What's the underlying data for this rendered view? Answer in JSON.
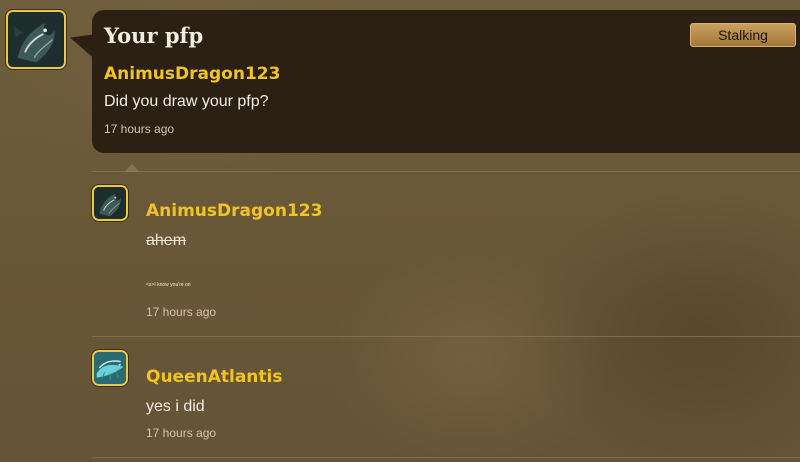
{
  "post": {
    "title": "Your pfp",
    "stalk_button": "Stalking",
    "author": "AnimusDragon123",
    "message": "Did you draw your pfp?",
    "time": "17 hours ago",
    "avatar_icon": "dragon-avatar-icon"
  },
  "comments": [
    {
      "author": "AnimusDragon123",
      "message": "ahem",
      "small_text": "<s>I know you're on",
      "time": "17 hours ago",
      "avatar_icon": "dragon-avatar-icon"
    },
    {
      "author": "QueenAtlantis",
      "message": "yes i did",
      "time": "17 hours ago",
      "avatar_icon": "teal-creature-avatar-icon"
    }
  ],
  "colors": {
    "username": "#f0c424",
    "bubble": "#2c2014",
    "avatar_border": "#e8c84a",
    "button": "#b58a48"
  }
}
